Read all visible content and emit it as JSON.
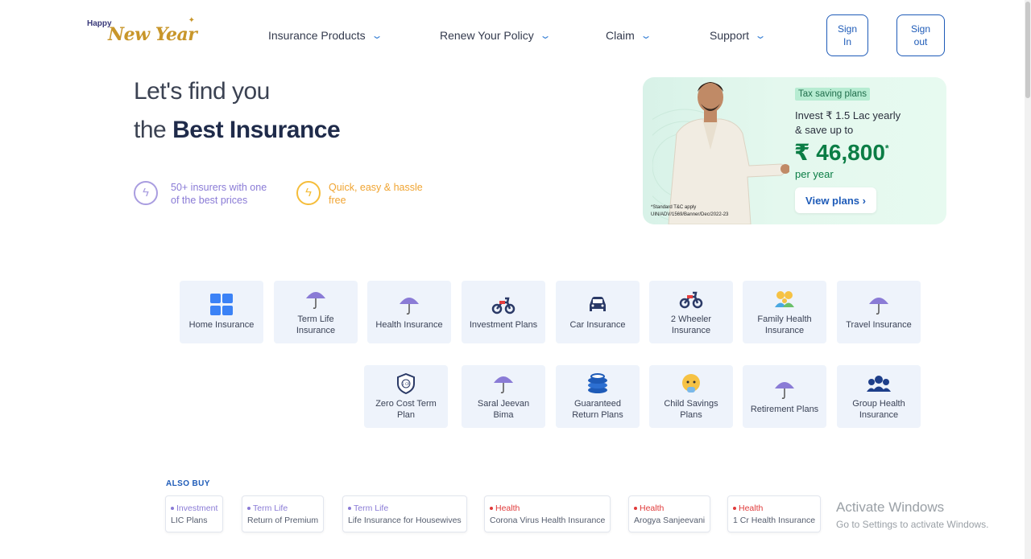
{
  "logo": {
    "line1": "Happy",
    "line2": "New Year"
  },
  "nav": [
    {
      "label": "Insurance Products"
    },
    {
      "label": "Renew Your Policy"
    },
    {
      "label": "Claim"
    },
    {
      "label": "Support"
    }
  ],
  "auth": {
    "sign_in": "Sign In",
    "sign_out": "Sign out"
  },
  "hero": {
    "line1": "Let's find you",
    "line2_prefix": "the",
    "line2_bold": "Best Insurance",
    "features": [
      {
        "text": "50+ insurers with one of the best prices",
        "color": "#8a7bd6"
      },
      {
        "text": "Quick, easy & hassle free",
        "color": "#f0a431"
      }
    ]
  },
  "banner": {
    "tag": "Tax saving plans",
    "line1": "Invest ₹ 1.5 Lac yearly",
    "line2": "& save up to",
    "amount": "₹ 46,800",
    "amount_mark": "*",
    "per": "per year",
    "cta": "View plans ›",
    "disclaimer1": "*Standard T&C apply",
    "disclaimer2": "UIN/ADV/1569/Banner/Dec/2022-23"
  },
  "products_row1": [
    {
      "label": "Home Insurance",
      "icon": "grid-icon"
    },
    {
      "label": "Term Life Insurance",
      "icon": "umbrella-icon"
    },
    {
      "label": "Health Insurance",
      "icon": "umbrella-icon"
    },
    {
      "label": "Investment Plans",
      "icon": "motorbike-icon"
    },
    {
      "label": "Car Insurance",
      "icon": "car-icon"
    },
    {
      "label": "2 Wheeler Insurance",
      "icon": "motorbike-icon"
    },
    {
      "label": "Family Health Insurance",
      "icon": "family-icon"
    },
    {
      "label": "Travel Insurance",
      "icon": "umbrella-icon"
    }
  ],
  "products_row2": [
    {
      "label": "Zero Cost Term Plan",
      "icon": "shield-icon"
    },
    {
      "label": "Saral Jeevan Bima",
      "icon": "umbrella-icon"
    },
    {
      "label": "Guaranteed Return Plans",
      "icon": "coins-icon"
    },
    {
      "label": "Child Savings Plans",
      "icon": "baby-icon"
    },
    {
      "label": "Retirement Plans",
      "icon": "umbrella-icon"
    },
    {
      "label": "Group Health Insurance",
      "icon": "group-icon"
    }
  ],
  "also_buy": {
    "title": "ALSO BUY",
    "items": [
      {
        "category": "Investment",
        "name": "LIC Plans",
        "color": "#8a7bd6"
      },
      {
        "category": "Term Life",
        "name": "Return of Premium",
        "color": "#8a7bd6"
      },
      {
        "category": "Term Life",
        "name": "Life Insurance for Housewives",
        "color": "#8a7bd6"
      },
      {
        "category": "Health",
        "name": "Corona Virus Health Insurance",
        "color": "#e03a3a"
      },
      {
        "category": "Health",
        "name": "Arogya Sanjeevani",
        "color": "#e03a3a"
      },
      {
        "category": "Health",
        "name": "1 Cr Health Insurance",
        "color": "#e03a3a"
      }
    ]
  },
  "watermark": {
    "line1": "Activate Windows",
    "line2": "Go to Settings to activate Windows."
  },
  "colors": {
    "primary": "#1e5bb8",
    "tile_bg": "#eef3fb",
    "banner_green": "#0b7d45"
  }
}
